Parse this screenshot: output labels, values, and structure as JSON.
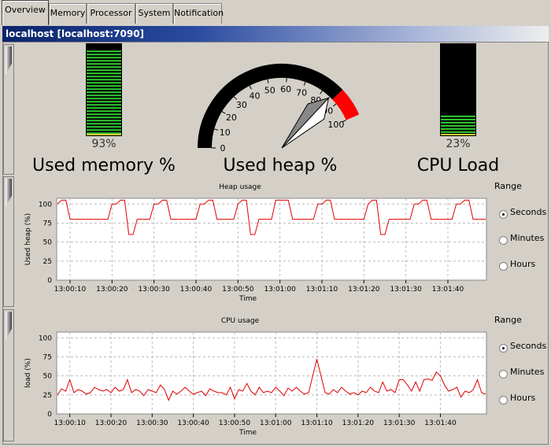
{
  "tabs": [
    {
      "label": "Overview",
      "active": true
    },
    {
      "label": "Memory",
      "active": false
    },
    {
      "label": "Processor",
      "active": false
    },
    {
      "label": "System",
      "active": false
    },
    {
      "label": "Notification",
      "active": false
    }
  ],
  "window_title": "localhost [localhost:7090]",
  "gauges": {
    "memory": {
      "percent_label": "93%",
      "value": 93,
      "caption": "Used memory %"
    },
    "heap": {
      "caption": "Used heap %",
      "value": 85,
      "ticks": [
        "0",
        "10",
        "20",
        "30",
        "40",
        "50",
        "60",
        "70",
        "80",
        "90",
        "100"
      ]
    },
    "cpu": {
      "percent_label": "23%",
      "value": 23,
      "caption": "CPU Load"
    }
  },
  "charts": {
    "heap": {
      "title": "Heap usage",
      "ylabel": "Used heap (%)",
      "xlabel": "Time",
      "yticks": [
        "0",
        "25",
        "50",
        "75",
        "100"
      ],
      "xticks": [
        "13:00:10",
        "13:00:20",
        "13:00:30",
        "13:00:40",
        "13:00:50",
        "13:01:00",
        "13:01:10",
        "13:01:20",
        "13:01:30",
        "13:01:40"
      ],
      "range": {
        "title": "Range",
        "options": [
          "Seconds",
          "Minutes",
          "Hours"
        ],
        "selected": "Seconds"
      }
    },
    "cpu": {
      "title": "CPU usage",
      "ylabel": "load (%)",
      "xlabel": "Time",
      "yticks": [
        "0",
        "25",
        "50",
        "75",
        "100"
      ],
      "xticks": [
        "13:00:10",
        "13:00:20",
        "13:00:30",
        "13:00:40",
        "13:00:50",
        "13:01:00",
        "13:01:10",
        "13:01:20",
        "13:01:30",
        "13:01:40"
      ],
      "range": {
        "title": "Range",
        "options": [
          "Seconds",
          "Minutes",
          "Hours"
        ],
        "selected": "Seconds"
      }
    }
  },
  "chart_data": [
    {
      "type": "line",
      "title": "Heap usage",
      "xlabel": "Time",
      "ylabel": "Used heap (%)",
      "ylim": [
        0,
        100
      ],
      "x": [
        "13:00:07",
        "13:00:08",
        "13:00:09",
        "13:00:10",
        "13:00:11",
        "13:00:12",
        "13:00:13",
        "13:00:14",
        "13:00:15",
        "13:00:16",
        "13:00:17",
        "13:00:18",
        "13:00:19",
        "13:00:20",
        "13:00:21",
        "13:00:22",
        "13:00:23",
        "13:00:24",
        "13:00:25",
        "13:00:26",
        "13:00:27",
        "13:00:28",
        "13:00:29",
        "13:00:30",
        "13:00:31",
        "13:00:32",
        "13:00:33",
        "13:00:34",
        "13:00:35",
        "13:00:36",
        "13:00:37",
        "13:00:38",
        "13:00:39",
        "13:00:40",
        "13:00:41",
        "13:00:42",
        "13:00:43",
        "13:00:44",
        "13:00:45",
        "13:00:46",
        "13:00:47",
        "13:00:48",
        "13:00:49",
        "13:00:50",
        "13:00:51",
        "13:00:52",
        "13:00:53",
        "13:00:54",
        "13:00:55",
        "13:00:56",
        "13:00:57",
        "13:00:58",
        "13:00:59",
        "13:01:00",
        "13:01:01",
        "13:01:02",
        "13:01:03",
        "13:01:04",
        "13:01:05",
        "13:01:06",
        "13:01:07",
        "13:01:08",
        "13:01:09",
        "13:01:10",
        "13:01:11",
        "13:01:12",
        "13:01:13",
        "13:01:14",
        "13:01:15",
        "13:01:16",
        "13:01:17",
        "13:01:18",
        "13:01:19",
        "13:01:20",
        "13:01:21",
        "13:01:22",
        "13:01:23",
        "13:01:24",
        "13:01:25",
        "13:01:26",
        "13:01:27",
        "13:01:28",
        "13:01:29",
        "13:01:30",
        "13:01:31",
        "13:01:32",
        "13:01:33",
        "13:01:34",
        "13:01:35",
        "13:01:36",
        "13:01:37",
        "13:01:38",
        "13:01:39",
        "13:01:40",
        "13:01:41",
        "13:01:42",
        "13:01:43",
        "13:01:44",
        "13:01:45",
        "13:01:46",
        "13:01:47",
        "13:01:48",
        "13:01:49"
      ],
      "series": [
        {
          "values": [
            100,
            105,
            105,
            80,
            80,
            80,
            80,
            80,
            80,
            80,
            80,
            80,
            80,
            100,
            100,
            105,
            105,
            60,
            60,
            80,
            80,
            80,
            80,
            100,
            100,
            105,
            105,
            80,
            80,
            80,
            80,
            80,
            80,
            80,
            100,
            100,
            105,
            105,
            80,
            80,
            80,
            80,
            80,
            100,
            105,
            105,
            60,
            60,
            80,
            80,
            80,
            80,
            105,
            105,
            105,
            105,
            80,
            80,
            80,
            80,
            80,
            80,
            100,
            100,
            105,
            105,
            80,
            80,
            80,
            80,
            80,
            80,
            80,
            80,
            100,
            105,
            105,
            60,
            60,
            80,
            80,
            80,
            80,
            80,
            80,
            100,
            100,
            105,
            105,
            80,
            80,
            80,
            80,
            80,
            80,
            100,
            100,
            105,
            105,
            80,
            80,
            80,
            80
          ]
        }
      ]
    },
    {
      "type": "line",
      "title": "CPU usage",
      "xlabel": "Time",
      "ylabel": "load (%)",
      "ylim": [
        0,
        100
      ],
      "x": [
        "13:00:07",
        "13:00:08",
        "13:00:09",
        "13:00:10",
        "13:00:11",
        "13:00:12",
        "13:00:13",
        "13:00:14",
        "13:00:15",
        "13:00:16",
        "13:00:17",
        "13:00:18",
        "13:00:19",
        "13:00:20",
        "13:00:21",
        "13:00:22",
        "13:00:23",
        "13:00:24",
        "13:00:25",
        "13:00:26",
        "13:00:27",
        "13:00:28",
        "13:00:29",
        "13:00:30",
        "13:00:31",
        "13:00:32",
        "13:00:33",
        "13:00:34",
        "13:00:35",
        "13:00:36",
        "13:00:37",
        "13:00:38",
        "13:00:39",
        "13:00:40",
        "13:00:41",
        "13:00:42",
        "13:00:43",
        "13:00:44",
        "13:00:45",
        "13:00:46",
        "13:00:47",
        "13:00:48",
        "13:00:49",
        "13:00:50",
        "13:00:51",
        "13:00:52",
        "13:00:53",
        "13:00:54",
        "13:00:55",
        "13:00:56",
        "13:00:57",
        "13:00:58",
        "13:00:59",
        "13:01:00",
        "13:01:01",
        "13:01:02",
        "13:01:03",
        "13:01:04",
        "13:01:05",
        "13:01:06",
        "13:01:07",
        "13:01:08",
        "13:01:09",
        "13:01:10",
        "13:01:11",
        "13:01:12",
        "13:01:13",
        "13:01:14",
        "13:01:15",
        "13:01:16",
        "13:01:17",
        "13:01:18",
        "13:01:19",
        "13:01:20",
        "13:01:21",
        "13:01:22",
        "13:01:23",
        "13:01:24",
        "13:01:25",
        "13:01:26",
        "13:01:27",
        "13:01:28",
        "13:01:29",
        "13:01:30",
        "13:01:31",
        "13:01:32",
        "13:01:33",
        "13:01:34",
        "13:01:35",
        "13:01:36",
        "13:01:37",
        "13:01:38",
        "13:01:39",
        "13:01:40",
        "13:01:41",
        "13:01:42",
        "13:01:43",
        "13:01:44",
        "13:01:45",
        "13:01:46",
        "13:01:47",
        "13:01:48",
        "13:01:49"
      ],
      "series": [
        {
          "values": [
            25,
            33,
            30,
            45,
            28,
            32,
            30,
            26,
            28,
            35,
            32,
            30,
            32,
            28,
            35,
            30,
            32,
            45,
            28,
            32,
            30,
            24,
            32,
            30,
            28,
            38,
            32,
            18,
            30,
            26,
            30,
            35,
            30,
            26,
            28,
            30,
            24,
            33,
            30,
            28,
            28,
            25,
            35,
            20,
            32,
            30,
            40,
            30,
            25,
            35,
            28,
            30,
            28,
            35,
            30,
            24,
            34,
            30,
            35,
            30,
            26,
            28,
            50,
            72,
            50,
            28,
            26,
            32,
            28,
            35,
            30,
            26,
            28,
            25,
            30,
            28,
            35,
            30,
            28,
            42,
            30,
            32,
            28,
            45,
            45,
            38,
            30,
            42,
            30,
            45,
            46,
            44,
            55,
            50,
            38,
            30,
            32,
            35,
            22,
            30,
            28,
            32,
            45,
            28,
            26
          ]
        }
      ]
    }
  ]
}
